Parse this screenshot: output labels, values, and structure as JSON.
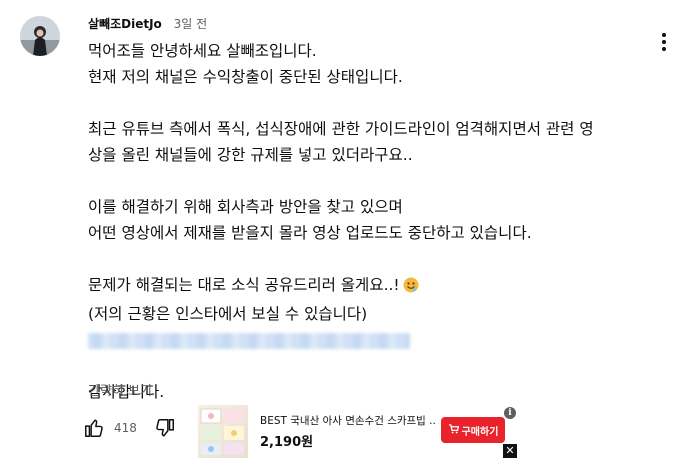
{
  "comment": {
    "author": "살빼조DietJo",
    "time": "3일 전",
    "lines": [
      "먹어조들 안녕하세요 살빼조입니다.",
      "현재 저의 채널은 수익창출이 중단된 상태입니다.",
      "최근 유튜브 측에서 폭식, 섭식장애에 관한 가이드라인이 엄격해지면서 관련 영",
      "상을 올린 채널들에 강한 규제를 넣고 있더라구요..",
      "이를 해결하기 위해 회사측과 방안을 찾고 있으며",
      "어떤 영상에서 제재를 받을지 몰라 영상 업로드도 중단하고 있습니다.",
      "문제가 해결되는 대로 소식 공유드리러 올게요..!",
      "(저의 근황은 인스타에서 보실 수 있습니다)",
      "감사합니다."
    ],
    "show_less": "간략히 보기",
    "like_count": "418"
  },
  "icons": {
    "menu": "more-vert-icon",
    "like": "thumb-up-icon",
    "dislike": "thumb-down-icon",
    "emoji": "drooling-face-emoji-icon",
    "cart": "cart-icon",
    "info": "info-icon",
    "close": "close-icon"
  },
  "ad": {
    "title": "BEST 국내산 아사 면손수건 스카프빕 ..",
    "price": "2,190원",
    "buy_label": "구매하기",
    "info_glyph": "i",
    "close_glyph": "✕"
  },
  "colors": {
    "text": "#0f0f0f",
    "secondary_text": "#606060",
    "buy_button": "#e8232b"
  }
}
